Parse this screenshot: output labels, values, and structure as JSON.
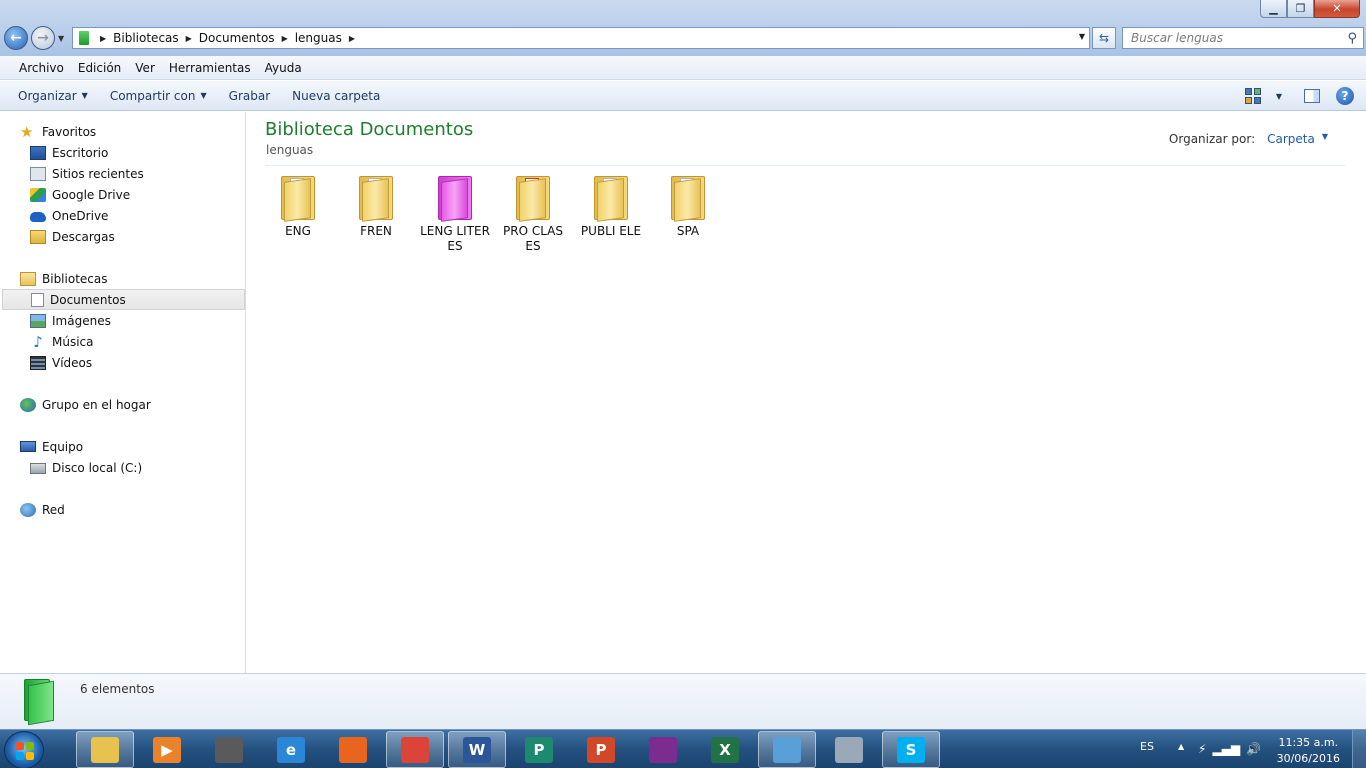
{
  "window": {
    "minimize": "▁",
    "maximize": "❐",
    "close": "✕"
  },
  "address": {
    "crumbs": [
      "Bibliotecas",
      "Documentos",
      "lenguas"
    ],
    "search_placeholder": "Buscar lenguas"
  },
  "menu": [
    "Archivo",
    "Edición",
    "Ver",
    "Herramientas",
    "Ayuda"
  ],
  "commands": {
    "organize": "Organizar",
    "share": "Compartir con",
    "burn": "Grabar",
    "new_folder": "Nueva carpeta"
  },
  "nav": {
    "favorites": "Favoritos",
    "desktop": "Escritorio",
    "recent": "Sitios recientes",
    "gdrive": "Google Drive",
    "onedrive": "OneDrive",
    "downloads": "Descargas",
    "libraries": "Bibliotecas",
    "documents": "Documentos",
    "images": "Imágenes",
    "music": "Música",
    "videos": "Vídeos",
    "homegroup": "Grupo en el hogar",
    "computer": "Equipo",
    "localdisk": "Disco local (C:)",
    "network": "Red"
  },
  "content": {
    "title": "Biblioteca Documentos",
    "subtitle": "lenguas",
    "arrange_label": "Organizar por:",
    "arrange_value": "Carpeta",
    "items": [
      {
        "name": "ENG",
        "style": "yellow"
      },
      {
        "name": "FREN",
        "style": "yellow"
      },
      {
        "name": "LENG LITER\nES",
        "style": "pink"
      },
      {
        "name": "PRO CLAS\nES",
        "style": "pdf"
      },
      {
        "name": "PUBLI ELE",
        "style": "yellow"
      },
      {
        "name": "SPA",
        "style": "yellow"
      }
    ]
  },
  "details": {
    "count": "6 elementos"
  },
  "taskbar": {
    "lang": "ES",
    "time": "11:35 a.m.",
    "date": "30/06/2016",
    "apps": [
      {
        "name": "explorer",
        "label": "",
        "color": "#e8c24e",
        "active": true
      },
      {
        "name": "media-player",
        "label": "▶",
        "color": "#e9822b",
        "active": false
      },
      {
        "name": "microphone",
        "label": "",
        "color": "#5a5a5a",
        "active": false
      },
      {
        "name": "internet-explorer",
        "label": "e",
        "color": "#2a86d6",
        "active": false
      },
      {
        "name": "firefox",
        "label": "",
        "color": "#e8641f",
        "active": false
      },
      {
        "name": "chrome",
        "label": "",
        "color": "#db4437",
        "active": true
      },
      {
        "name": "word",
        "label": "W",
        "color": "#2b579a",
        "active": true
      },
      {
        "name": "publisher",
        "label": "P",
        "color": "#1d8a6f",
        "active": false
      },
      {
        "name": "powerpoint",
        "label": "P",
        "color": "#d24726",
        "active": false
      },
      {
        "name": "winrar",
        "label": "",
        "color": "#7a2d8f",
        "active": false
      },
      {
        "name": "excel",
        "label": "X",
        "color": "#217346",
        "active": false
      },
      {
        "name": "messenger",
        "label": "",
        "color": "#5aa0d8",
        "active": true
      },
      {
        "name": "calculator",
        "label": "",
        "color": "#9aa8b8",
        "active": false
      },
      {
        "name": "skype",
        "label": "S",
        "color": "#00aff0",
        "active": true
      }
    ]
  }
}
